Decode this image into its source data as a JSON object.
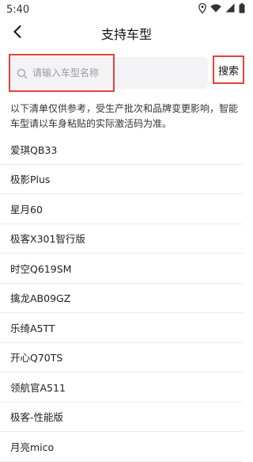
{
  "status_bar": {
    "time": "5:40",
    "icons": [
      "location-icon",
      "wifi-icon",
      "signal-icon",
      "battery-icon"
    ]
  },
  "header": {
    "title": "支持车型",
    "back_icon": "chevron-left-icon"
  },
  "search": {
    "placeholder": "请输入车型名称",
    "value": "",
    "button_label": "搜索",
    "highlight_color": "#e3413b"
  },
  "notice": "以下清单仅供参考，受生产批次和品牌变更影响，智能车型请以车身粘贴的实际激活码为准。",
  "models": [
    {
      "name": "爱琪QB33"
    },
    {
      "name": "极影Plus"
    },
    {
      "name": "星月60"
    },
    {
      "name": "极客X301智行版"
    },
    {
      "name": "时空Q619SM"
    },
    {
      "name": "擒龙AB09GZ"
    },
    {
      "name": "乐绮A5TT"
    },
    {
      "name": "开心Q70TS"
    },
    {
      "name": "领航官A511"
    },
    {
      "name": "极客-性能版"
    },
    {
      "name": "月亮mico"
    }
  ]
}
